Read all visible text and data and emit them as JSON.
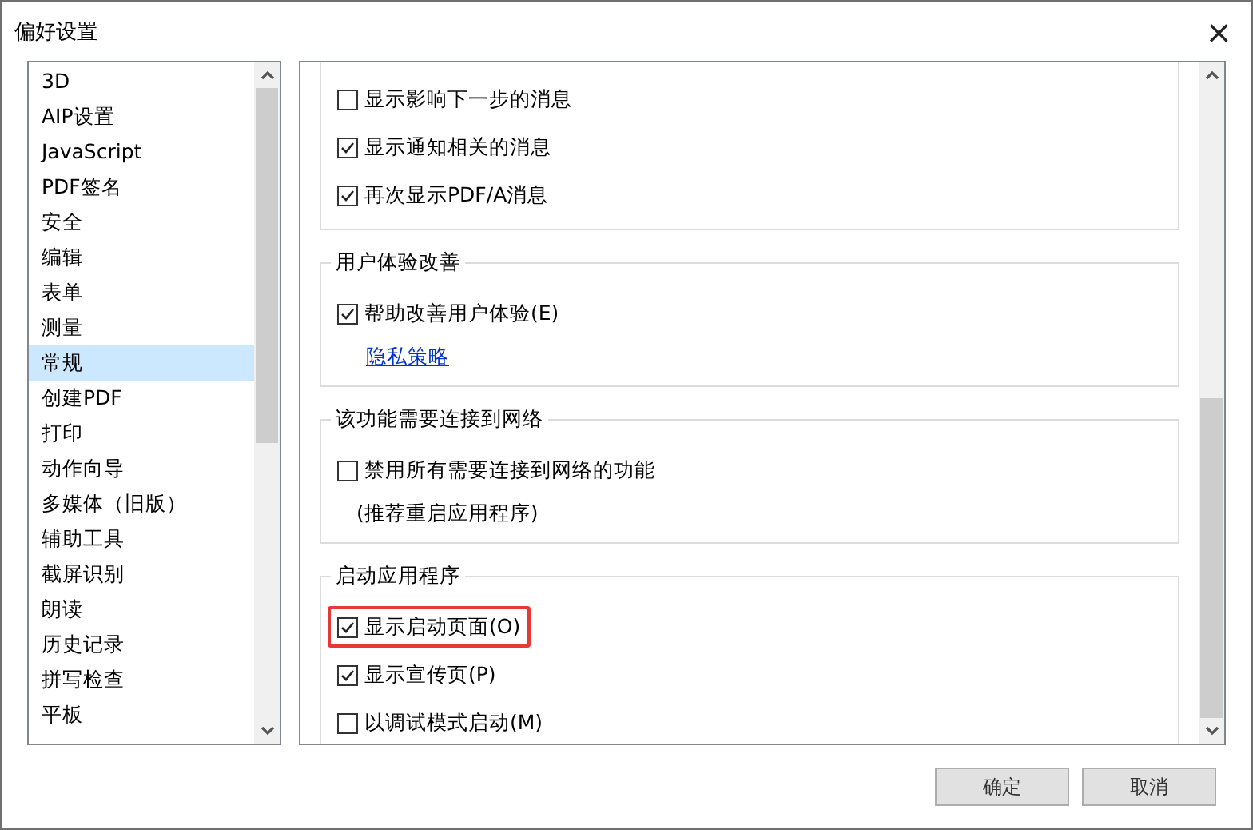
{
  "window": {
    "title": "偏好设置",
    "close": "×"
  },
  "sidebar": {
    "items": [
      {
        "label": "3D",
        "selected": false
      },
      {
        "label": "AIP设置",
        "selected": false
      },
      {
        "label": "JavaScript",
        "selected": false
      },
      {
        "label": "PDF签名",
        "selected": false
      },
      {
        "label": "安全",
        "selected": false
      },
      {
        "label": "编辑",
        "selected": false
      },
      {
        "label": "表单",
        "selected": false
      },
      {
        "label": "测量",
        "selected": false
      },
      {
        "label": "常规",
        "selected": true
      },
      {
        "label": "创建PDF",
        "selected": false
      },
      {
        "label": "打印",
        "selected": false
      },
      {
        "label": "动作向导",
        "selected": false
      },
      {
        "label": "多媒体（旧版）",
        "selected": false
      },
      {
        "label": "辅助工具",
        "selected": false
      },
      {
        "label": "截屏识别",
        "selected": false
      },
      {
        "label": "朗读",
        "selected": false
      },
      {
        "label": "历史记录",
        "selected": false
      },
      {
        "label": "拼写检查",
        "selected": false
      },
      {
        "label": "平板",
        "selected": false
      }
    ]
  },
  "groups": [
    {
      "items": [
        {
          "kind": "checkbox",
          "label": "显示影响下一步的消息",
          "checked": false,
          "highlighted": false
        },
        {
          "kind": "checkbox",
          "label": "显示通知相关的消息",
          "checked": true,
          "highlighted": false
        },
        {
          "kind": "checkbox",
          "label": "再次显示PDF/A消息",
          "checked": true,
          "highlighted": false
        }
      ]
    },
    {
      "title": "用户体验改善",
      "items": [
        {
          "kind": "checkbox",
          "label": "帮助改善用户体验(E)",
          "checked": true,
          "highlighted": false
        },
        {
          "kind": "link",
          "label": "隐私策略"
        }
      ]
    },
    {
      "title": "该功能需要连接到网络",
      "items": [
        {
          "kind": "checkbox",
          "label": "禁用所有需要连接到网络的功能",
          "checked": false,
          "highlighted": false
        },
        {
          "kind": "note",
          "label": "(推荐重启应用程序)"
        }
      ]
    },
    {
      "title": "启动应用程序",
      "items": [
        {
          "kind": "checkbox",
          "label": "显示启动页面(O)",
          "checked": true,
          "highlighted": true
        },
        {
          "kind": "checkbox",
          "label": "显示宣传页(P)",
          "checked": true,
          "highlighted": false
        },
        {
          "kind": "checkbox",
          "label": "以调试模式启动(M)",
          "checked": false,
          "highlighted": false
        }
      ]
    }
  ],
  "buttons": [
    "确定",
    "取消"
  ]
}
